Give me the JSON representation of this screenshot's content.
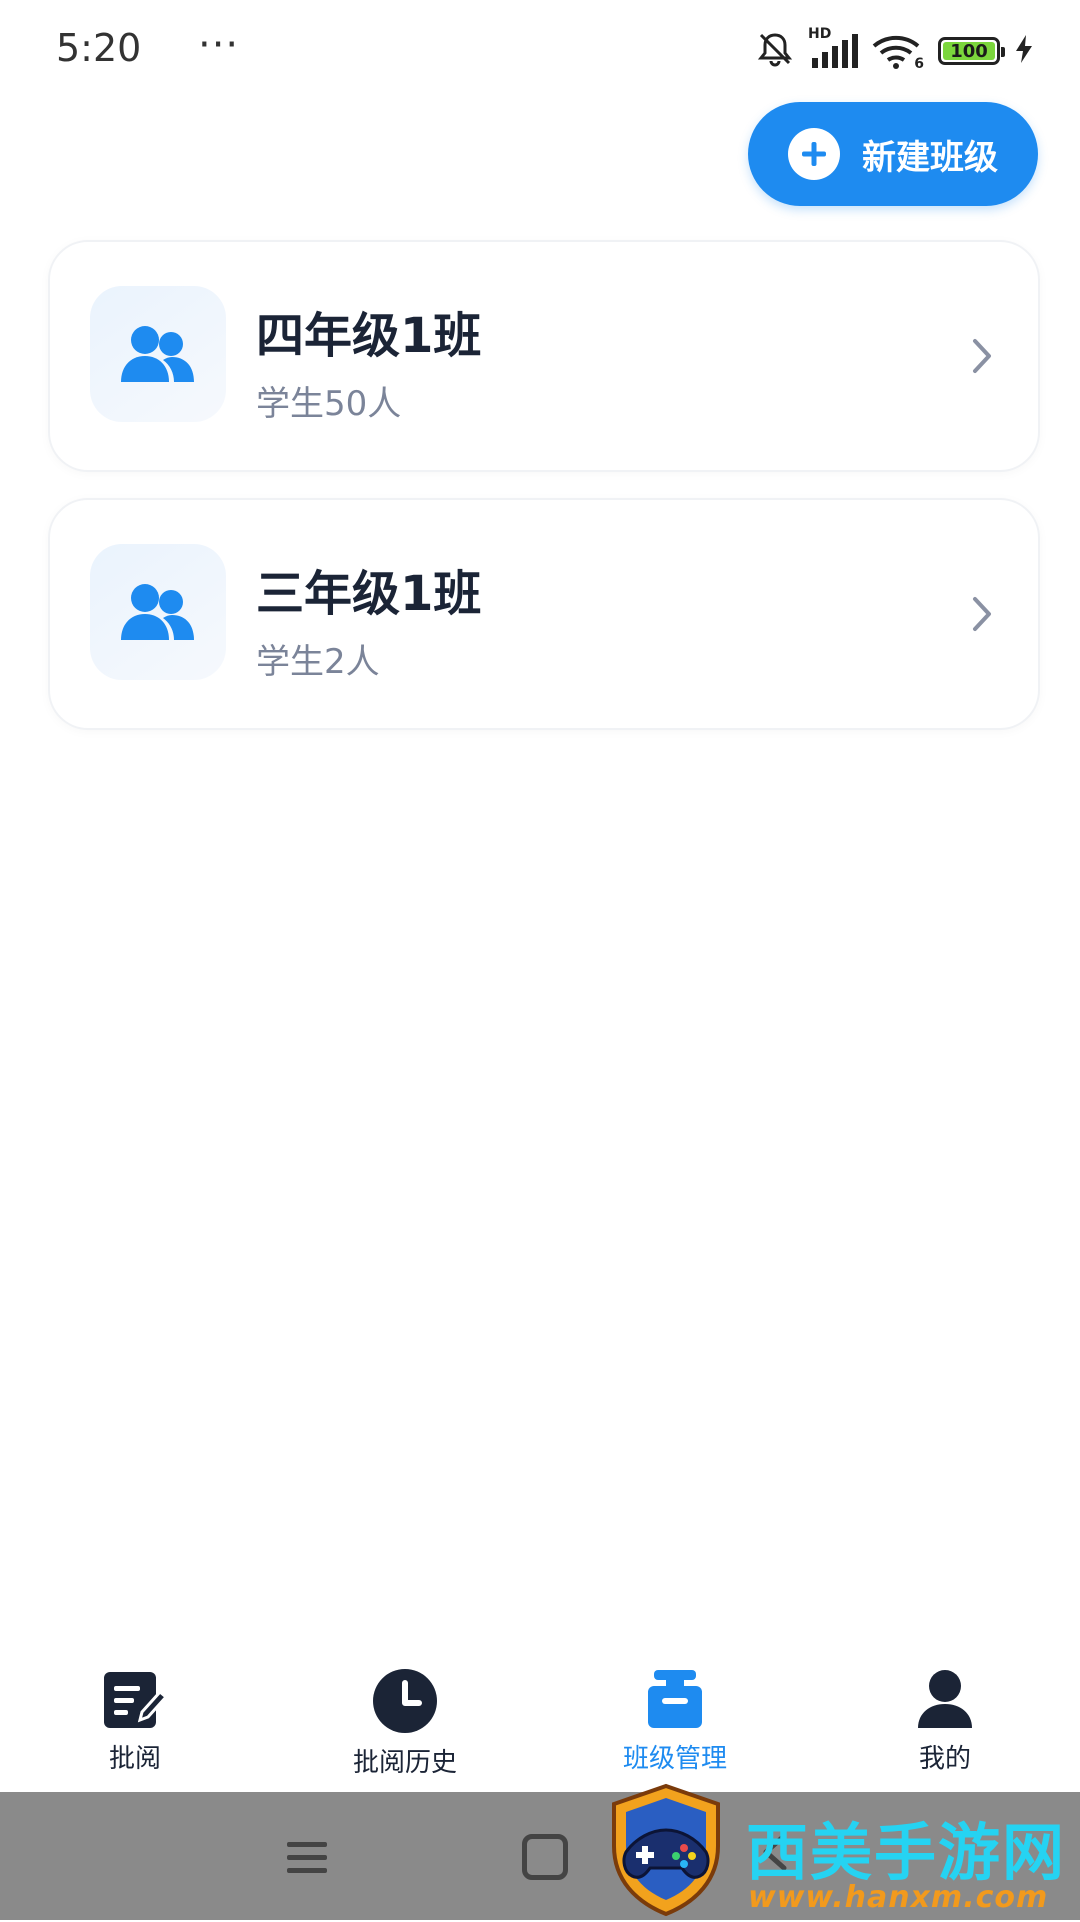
{
  "status_bar": {
    "time": "5:20",
    "more": "···",
    "network_label": "HD",
    "wifi_label": "6",
    "battery": "100"
  },
  "actions": {
    "new_class_label": "新建班级"
  },
  "classes": [
    {
      "name": "四年级1班",
      "count": "学生50人"
    },
    {
      "name": "三年级1班",
      "count": "学生2人"
    }
  ],
  "bottom_nav": {
    "items": [
      {
        "label": "批阅",
        "icon": "edit-icon"
      },
      {
        "label": "批阅历史",
        "icon": "clock-icon"
      },
      {
        "label": "班级管理",
        "icon": "class-icon",
        "active": true
      },
      {
        "label": "我的",
        "icon": "user-icon"
      }
    ]
  },
  "watermark": {
    "title": "西美手游网",
    "url": "www.hanxm.com"
  },
  "colors": {
    "accent": "#1e8bf0",
    "text_primary": "#1b2436",
    "text_secondary": "#7b8499"
  }
}
